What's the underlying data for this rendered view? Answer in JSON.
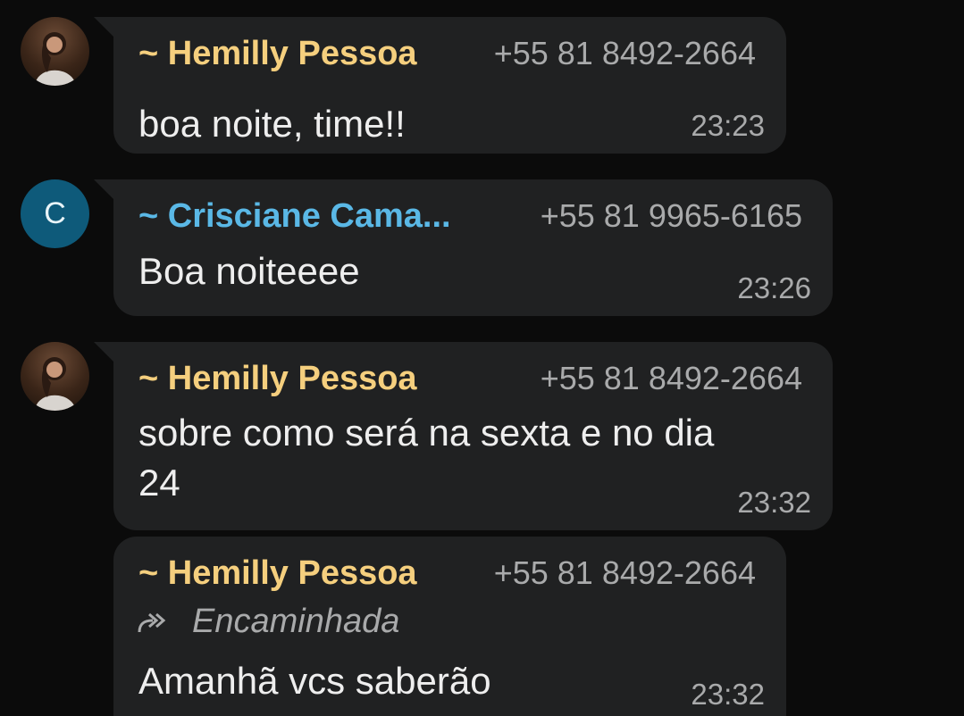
{
  "messages": [
    {
      "sender": "~ Hemilly Pessoa",
      "phone": "+55 81 8492-2664",
      "text": "boa noite, time!!",
      "time": "23:23",
      "avatar": "profile-photo"
    },
    {
      "sender": "~ Crisciane Cama...",
      "phone": "+55 81 9965-6165",
      "text": "Boa noiteeee",
      "time": "23:26",
      "avatar_letter": "C"
    },
    {
      "sender": "~ Hemilly Pessoa",
      "phone": "+55 81 8492-2664",
      "text_line1": "sobre como será na sexta e no dia",
      "text_line2": "24",
      "time": "23:32",
      "avatar": "profile-photo"
    },
    {
      "sender": "~ Hemilly Pessoa",
      "phone": "+55 81 8492-2664",
      "forwarded_label": "Encaminhada",
      "text": "Amanhã vcs saberão",
      "time": "23:32"
    }
  ],
  "colors": {
    "background": "#0b0b0b",
    "bubble": "#202122",
    "sender_yellow": "#f5cf7e",
    "sender_blue": "#5ab8e6",
    "meta_gray": "#a9aaab",
    "avatar_c_bg": "#0e5a7a"
  }
}
